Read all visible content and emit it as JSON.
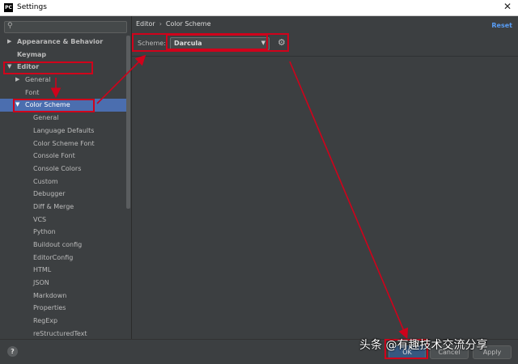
{
  "window": {
    "title": "Settings",
    "app_icon_text": "PC",
    "close_symbol": "✕"
  },
  "search": {
    "placeholder": "",
    "value": ""
  },
  "tree": [
    {
      "label": "Appearance & Behavior",
      "arrow": "▶",
      "bold": true,
      "indent": 0
    },
    {
      "label": "Keymap",
      "arrow": "",
      "bold": true,
      "indent": 0
    },
    {
      "label": "Editor",
      "arrow": "▼",
      "bold": true,
      "indent": 0
    },
    {
      "label": "General",
      "arrow": "▶",
      "bold": false,
      "indent": 1
    },
    {
      "label": "Font",
      "arrow": "",
      "bold": false,
      "indent": 1
    },
    {
      "label": "Color Scheme",
      "arrow": "▼",
      "bold": false,
      "indent": 1,
      "selected": true
    },
    {
      "label": "General",
      "arrow": "",
      "bold": false,
      "indent": 2
    },
    {
      "label": "Language Defaults",
      "arrow": "",
      "bold": false,
      "indent": 2
    },
    {
      "label": "Color Scheme Font",
      "arrow": "",
      "bold": false,
      "indent": 2
    },
    {
      "label": "Console Font",
      "arrow": "",
      "bold": false,
      "indent": 2
    },
    {
      "label": "Console Colors",
      "arrow": "",
      "bold": false,
      "indent": 2
    },
    {
      "label": "Custom",
      "arrow": "",
      "bold": false,
      "indent": 2
    },
    {
      "label": "Debugger",
      "arrow": "",
      "bold": false,
      "indent": 2
    },
    {
      "label": "Diff & Merge",
      "arrow": "",
      "bold": false,
      "indent": 2
    },
    {
      "label": "VCS",
      "arrow": "",
      "bold": false,
      "indent": 2
    },
    {
      "label": "Python",
      "arrow": "",
      "bold": false,
      "indent": 2
    },
    {
      "label": "Buildout config",
      "arrow": "",
      "bold": false,
      "indent": 2
    },
    {
      "label": "EditorConfig",
      "arrow": "",
      "bold": false,
      "indent": 2
    },
    {
      "label": "HTML",
      "arrow": "",
      "bold": false,
      "indent": 2
    },
    {
      "label": "JSON",
      "arrow": "",
      "bold": false,
      "indent": 2
    },
    {
      "label": "Markdown",
      "arrow": "",
      "bold": false,
      "indent": 2
    },
    {
      "label": "Properties",
      "arrow": "",
      "bold": false,
      "indent": 2
    },
    {
      "label": "RegExp",
      "arrow": "",
      "bold": false,
      "indent": 2
    },
    {
      "label": "reStructuredText",
      "arrow": "",
      "bold": false,
      "indent": 2
    }
  ],
  "breadcrumb": {
    "parent": "Editor",
    "separator": "›",
    "current": "Color Scheme"
  },
  "reset_label": "Reset",
  "scheme": {
    "label": "Scheme:",
    "value": "Darcula"
  },
  "footer": {
    "help_label": "?",
    "ok_label": "OK",
    "cancel_label": "Cancel",
    "apply_label": "Apply"
  },
  "watermark": "头条 @有趣技术交流分享",
  "colors": {
    "background": "#3c3f41",
    "selection": "#4b6eaf",
    "link": "#589df6",
    "annotation": "#d0021b"
  }
}
